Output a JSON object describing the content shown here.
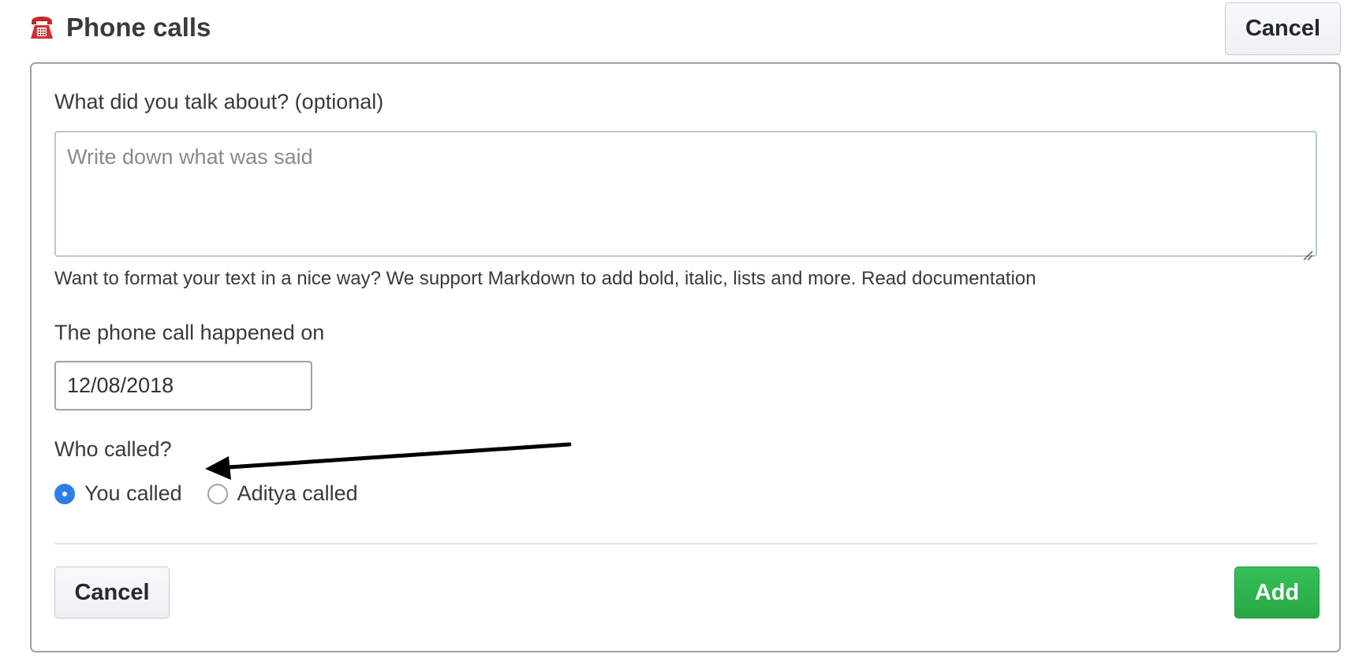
{
  "header": {
    "icon": "telephone-icon",
    "title": "Phone calls",
    "cancel_label": "Cancel"
  },
  "form": {
    "talk_label": "What did you talk about? (optional)",
    "talk_placeholder": "Write down what was said",
    "talk_value": "",
    "help_text": "Want to format your text in a nice way? We support Markdown to add bold, italic, lists and more. Read documentation",
    "date_label": "The phone call happened on",
    "date_value": "12/08/2018",
    "who_label": "Who called?",
    "who_options": [
      {
        "label": "You called",
        "checked": true
      },
      {
        "label": "Aditya called",
        "checked": false
      }
    ]
  },
  "footer": {
    "cancel_label": "Cancel",
    "add_label": "Add"
  },
  "colors": {
    "add_button": "#28a745",
    "radio_selected": "#2d7fe8",
    "phone_icon": "#d32f2f"
  }
}
